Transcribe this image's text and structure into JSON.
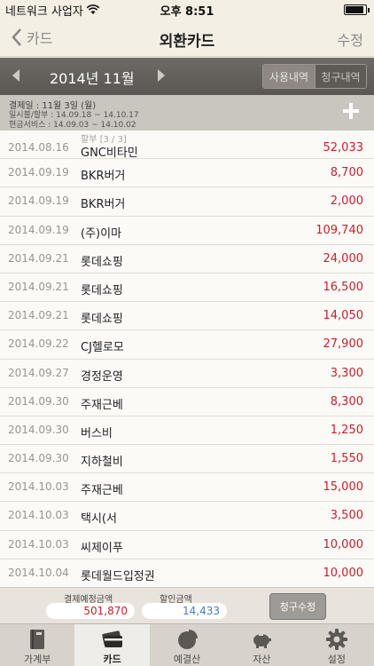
{
  "status": {
    "carrier": "네트워크 사업자",
    "time": "오후 8:51"
  },
  "nav": {
    "back_label": "카드",
    "title": "외환카드",
    "edit_label": "수정"
  },
  "month_bar": {
    "label": "2014년 11월",
    "seg_usage": "사용내역",
    "seg_bill": "청구내역"
  },
  "info": {
    "line1": "결제일 : 11월 3일 (월)",
    "line2": "일시불/할부 : 14.09.18 ~ 14.10.17",
    "line3": "현금서비스 : 14.09.03 ~ 14.10.02"
  },
  "transactions": [
    {
      "date": "2014.08.16",
      "merchant": "GNC비타민",
      "sub": "할부 [3 / 3]",
      "amount": "52,033"
    },
    {
      "date": "2014.09.19",
      "merchant": "BKR버거",
      "sub": "",
      "amount": "8,700"
    },
    {
      "date": "2014.09.19",
      "merchant": "BKR버거",
      "sub": "",
      "amount": "2,000"
    },
    {
      "date": "2014.09.19",
      "merchant": "(주)이마",
      "sub": "",
      "amount": "109,740"
    },
    {
      "date": "2014.09.21",
      "merchant": "롯데쇼핑",
      "sub": "",
      "amount": "24,000"
    },
    {
      "date": "2014.09.21",
      "merchant": "롯데쇼핑",
      "sub": "",
      "amount": "16,500"
    },
    {
      "date": "2014.09.21",
      "merchant": "롯데쇼핑",
      "sub": "",
      "amount": "14,050"
    },
    {
      "date": "2014.09.22",
      "merchant": "CJ헬로모",
      "sub": "",
      "amount": "27,900"
    },
    {
      "date": "2014.09.27",
      "merchant": "경정운영",
      "sub": "",
      "amount": "3,300"
    },
    {
      "date": "2014.09.30",
      "merchant": "주재근베",
      "sub": "",
      "amount": "8,300"
    },
    {
      "date": "2014.09.30",
      "merchant": "버스비",
      "sub": "",
      "amount": "1,250"
    },
    {
      "date": "2014.09.30",
      "merchant": "지하철비",
      "sub": "",
      "amount": "1,550"
    },
    {
      "date": "2014.10.03",
      "merchant": "주재근베",
      "sub": "",
      "amount": "15,000"
    },
    {
      "date": "2014.10.03",
      "merchant": "택시(서",
      "sub": "",
      "amount": "3,500"
    },
    {
      "date": "2014.10.03",
      "merchant": "씨제이푸",
      "sub": "",
      "amount": "10,000"
    },
    {
      "date": "2014.10.04",
      "merchant": "롯데월드입정권",
      "sub": "",
      "amount": "10,000"
    }
  ],
  "summary": {
    "expected_label": "결제예정금액",
    "expected_value": "501,870",
    "discount_label": "할인금액",
    "discount_value": "14,433",
    "claim_button": "청구수정"
  },
  "tabs": [
    {
      "label": "가계부",
      "icon": "book-icon"
    },
    {
      "label": "카드",
      "icon": "card-icon"
    },
    {
      "label": "예결산",
      "icon": "pie-chart-icon"
    },
    {
      "label": "자산",
      "icon": "piggy-bank-icon"
    },
    {
      "label": "설정",
      "icon": "gear-icon"
    }
  ],
  "colors": {
    "amount": "#c8202a",
    "discount": "#4a7bbf",
    "month_bar": "#5f5b57"
  }
}
